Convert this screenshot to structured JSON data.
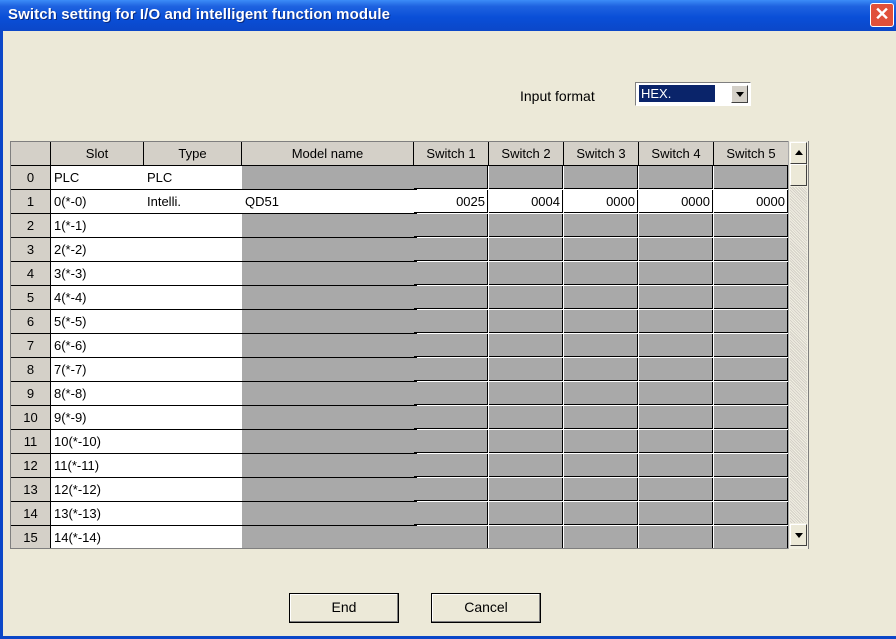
{
  "window": {
    "title": "Switch setting for I/O and intelligent function module"
  },
  "input_format": {
    "label": "Input format",
    "value": "HEX."
  },
  "table": {
    "headers": [
      "",
      "Slot",
      "Type",
      "Model name",
      "Switch 1",
      "Switch 2",
      "Switch 3",
      "Switch 4",
      "Switch 5"
    ],
    "rows": [
      {
        "num": "0",
        "slot": "PLC",
        "type": "PLC",
        "model": "",
        "sw": [
          "",
          "",
          "",
          "",
          ""
        ]
      },
      {
        "num": "1",
        "slot": "0(*-0)",
        "type": "Intelli.",
        "model": "QD51",
        "sw": [
          "0025",
          "0004",
          "0000",
          "0000",
          "0000"
        ]
      },
      {
        "num": "2",
        "slot": "1(*-1)",
        "type": "",
        "model": "",
        "sw": [
          "",
          "",
          "",
          "",
          ""
        ]
      },
      {
        "num": "3",
        "slot": "2(*-2)",
        "type": "",
        "model": "",
        "sw": [
          "",
          "",
          "",
          "",
          ""
        ]
      },
      {
        "num": "4",
        "slot": "3(*-3)",
        "type": "",
        "model": "",
        "sw": [
          "",
          "",
          "",
          "",
          ""
        ]
      },
      {
        "num": "5",
        "slot": "4(*-4)",
        "type": "",
        "model": "",
        "sw": [
          "",
          "",
          "",
          "",
          ""
        ]
      },
      {
        "num": "6",
        "slot": "5(*-5)",
        "type": "",
        "model": "",
        "sw": [
          "",
          "",
          "",
          "",
          ""
        ]
      },
      {
        "num": "7",
        "slot": "6(*-6)",
        "type": "",
        "model": "",
        "sw": [
          "",
          "",
          "",
          "",
          ""
        ]
      },
      {
        "num": "8",
        "slot": "7(*-7)",
        "type": "",
        "model": "",
        "sw": [
          "",
          "",
          "",
          "",
          ""
        ]
      },
      {
        "num": "9",
        "slot": "8(*-8)",
        "type": "",
        "model": "",
        "sw": [
          "",
          "",
          "",
          "",
          ""
        ]
      },
      {
        "num": "10",
        "slot": "9(*-9)",
        "type": "",
        "model": "",
        "sw": [
          "",
          "",
          "",
          "",
          ""
        ]
      },
      {
        "num": "11",
        "slot": "10(*-10)",
        "type": "",
        "model": "",
        "sw": [
          "",
          "",
          "",
          "",
          ""
        ]
      },
      {
        "num": "12",
        "slot": "11(*-11)",
        "type": "",
        "model": "",
        "sw": [
          "",
          "",
          "",
          "",
          ""
        ]
      },
      {
        "num": "13",
        "slot": "12(*-12)",
        "type": "",
        "model": "",
        "sw": [
          "",
          "",
          "",
          "",
          ""
        ]
      },
      {
        "num": "14",
        "slot": "13(*-13)",
        "type": "",
        "model": "",
        "sw": [
          "",
          "",
          "",
          "",
          ""
        ]
      },
      {
        "num": "15",
        "slot": "14(*-14)",
        "type": "",
        "model": "",
        "sw": [
          "",
          "",
          "",
          "",
          ""
        ]
      }
    ]
  },
  "buttons": {
    "end": "End",
    "cancel": "Cancel"
  },
  "colors": {
    "titlebar": "#0b47c8",
    "dialog_bg": "#ece9d8",
    "grid_gray": "#a9a9a9",
    "selection": "#0a246a"
  }
}
